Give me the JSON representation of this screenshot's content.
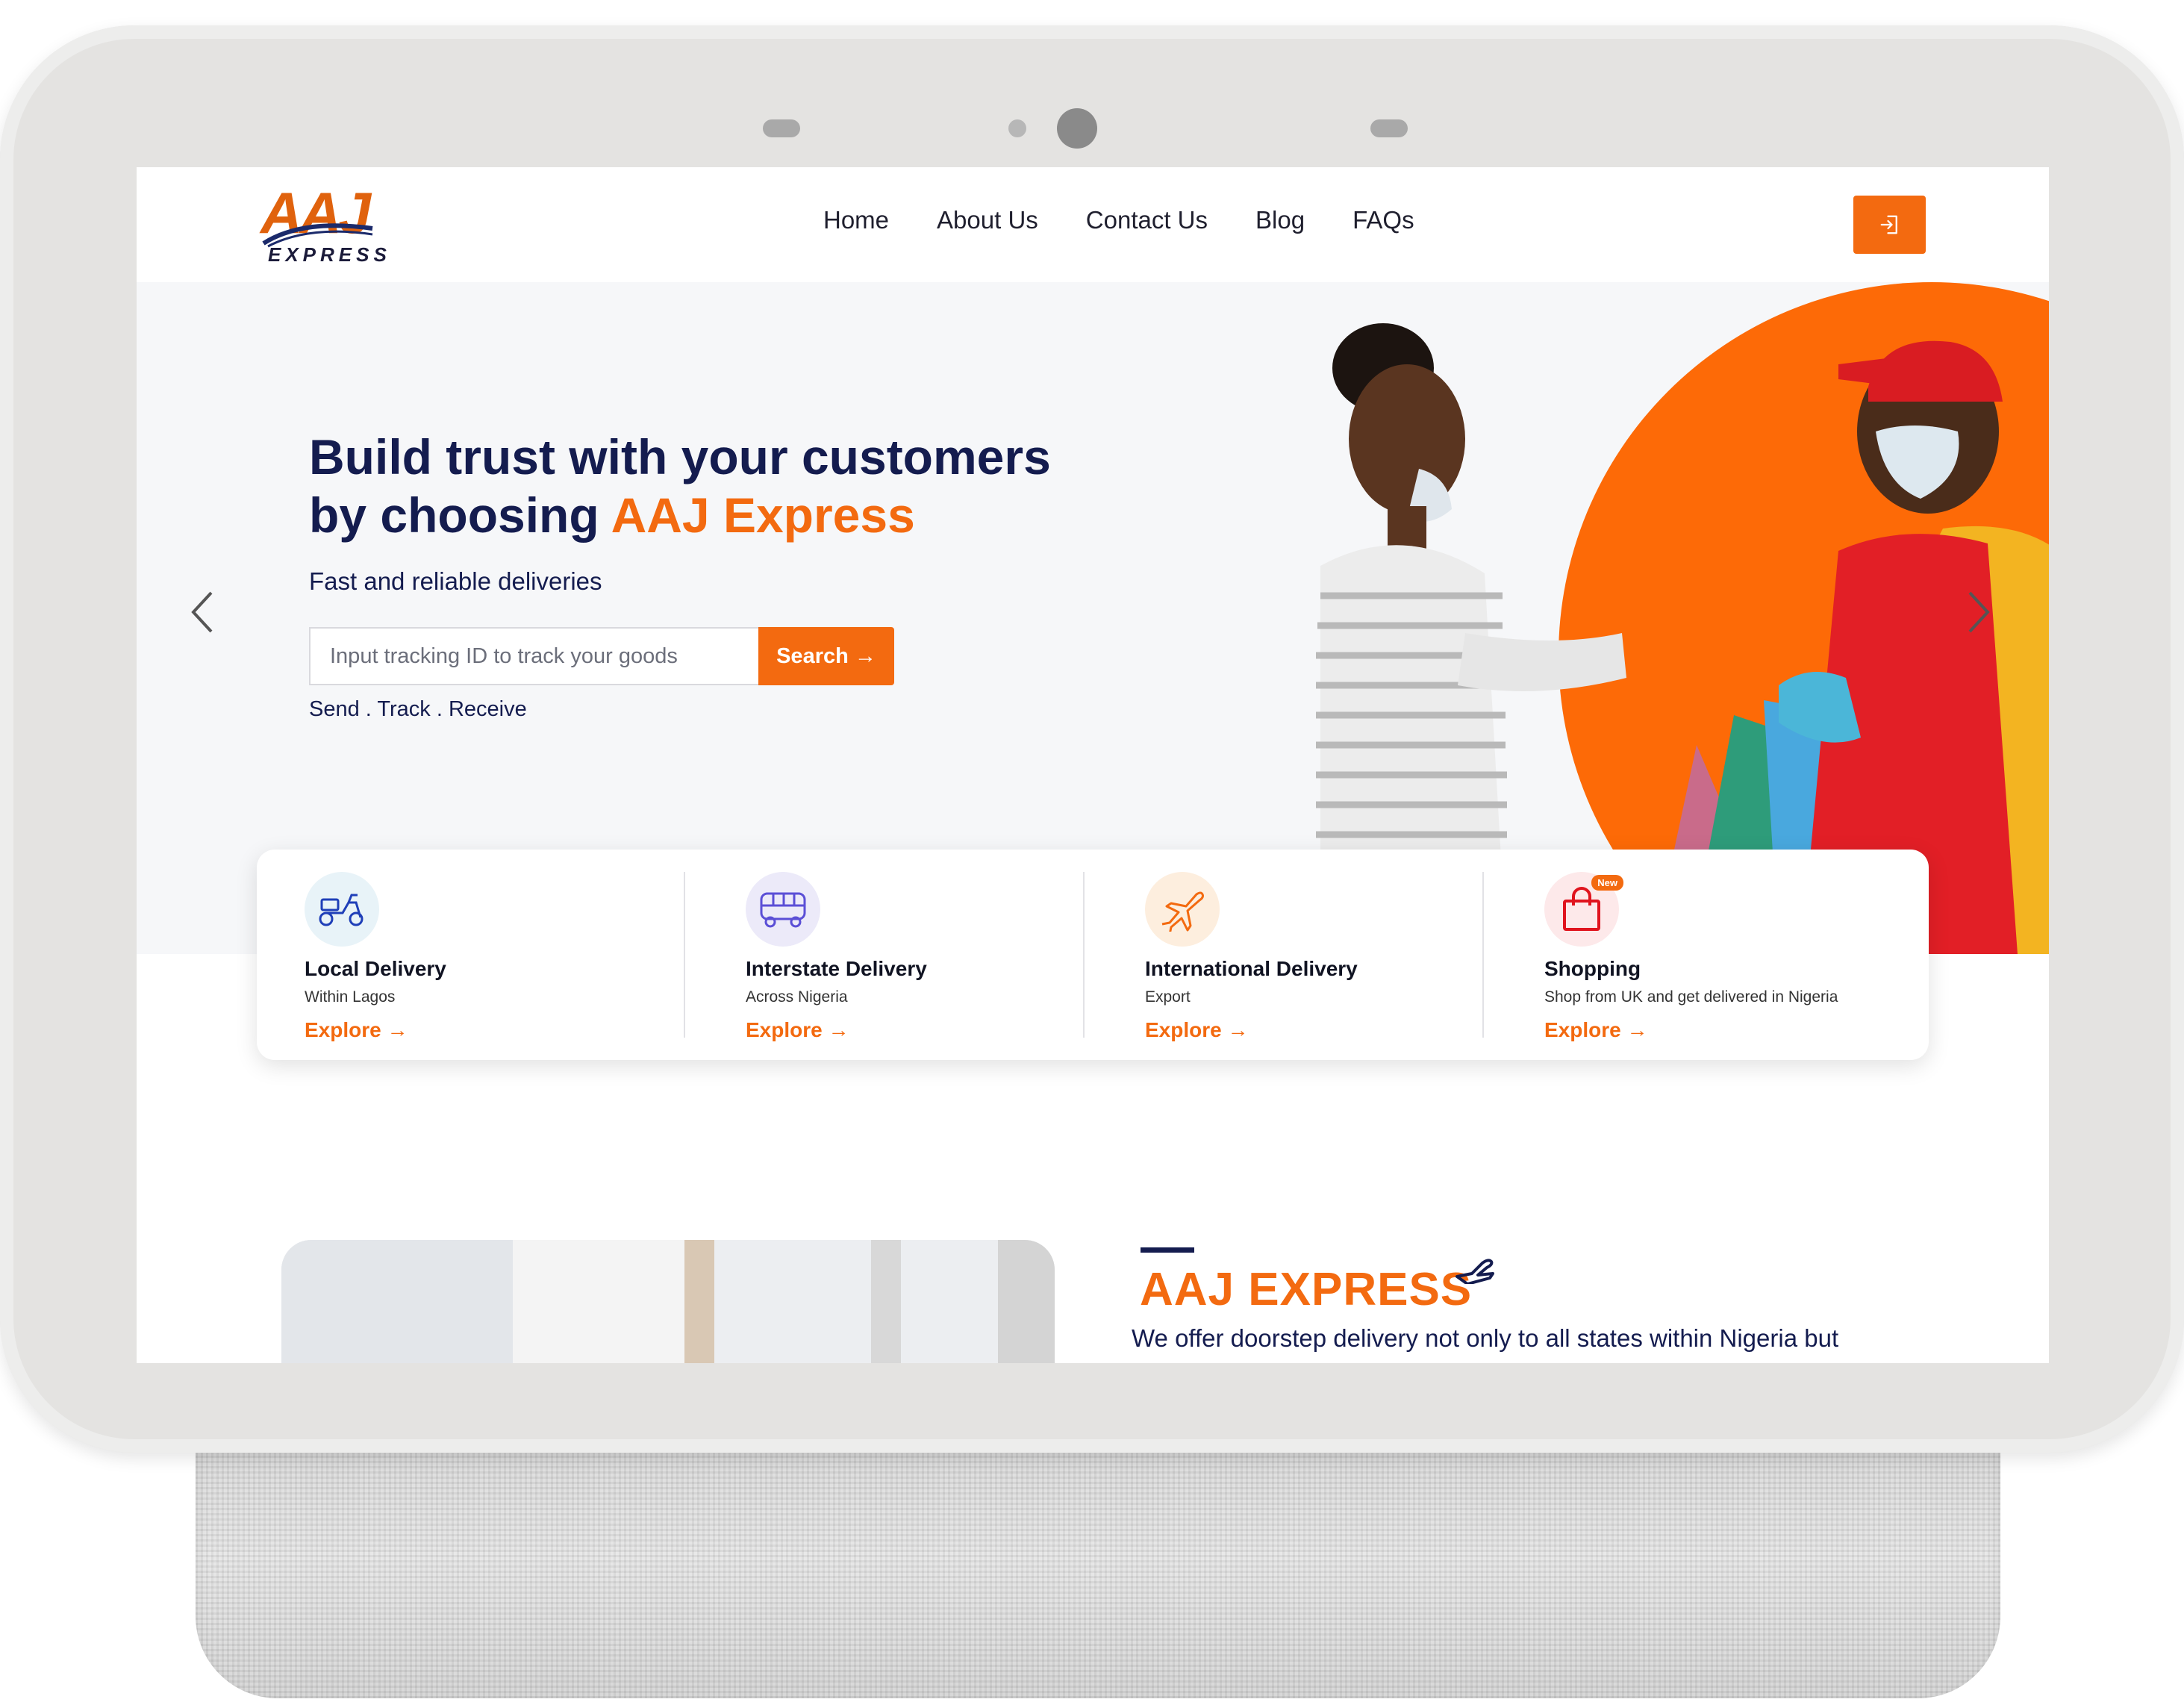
{
  "brand": {
    "logo_mark": "AAJ",
    "logo_word": "EXPRESS",
    "accent_color": "#f36a10",
    "navy_color": "#141c4f"
  },
  "nav": {
    "items": [
      "Home",
      "About Us",
      "Contact Us",
      "Blog",
      "FAQs"
    ],
    "login_icon": "sign-in-icon"
  },
  "hero": {
    "title_line1": "Build trust with your customers",
    "title_line2_prefix": "by choosing ",
    "title_line2_accent": "AAJ Express",
    "subtitle": "Fast and reliable deliveries",
    "search_placeholder": "Input tracking ID to track your goods",
    "search_value": "",
    "search_button": "Search →",
    "tagline": "Send . Track . Receive",
    "prev_icon": "chevron-left-icon",
    "next_icon": "chevron-right-icon"
  },
  "services": [
    {
      "title": "Local Delivery",
      "desc": "Within Lagos",
      "link": "Explore →",
      "icon": "scooter-icon",
      "badge": ""
    },
    {
      "title": "Interstate Delivery",
      "desc": "Across Nigeria",
      "link": "Explore →",
      "icon": "bus-icon",
      "badge": ""
    },
    {
      "title": "International Delivery",
      "desc": "Export",
      "link": "Explore →",
      "icon": "airplane-icon",
      "badge": ""
    },
    {
      "title": "Shopping",
      "desc": "Shop from UK and get delivered in Nigeria",
      "link": "Explore →",
      "icon": "shopping-bag-icon",
      "badge": "New"
    }
  ],
  "about": {
    "title": "AAJ EXPRESS",
    "text": "We offer doorstep delivery not only to all states within Nigeria but"
  }
}
